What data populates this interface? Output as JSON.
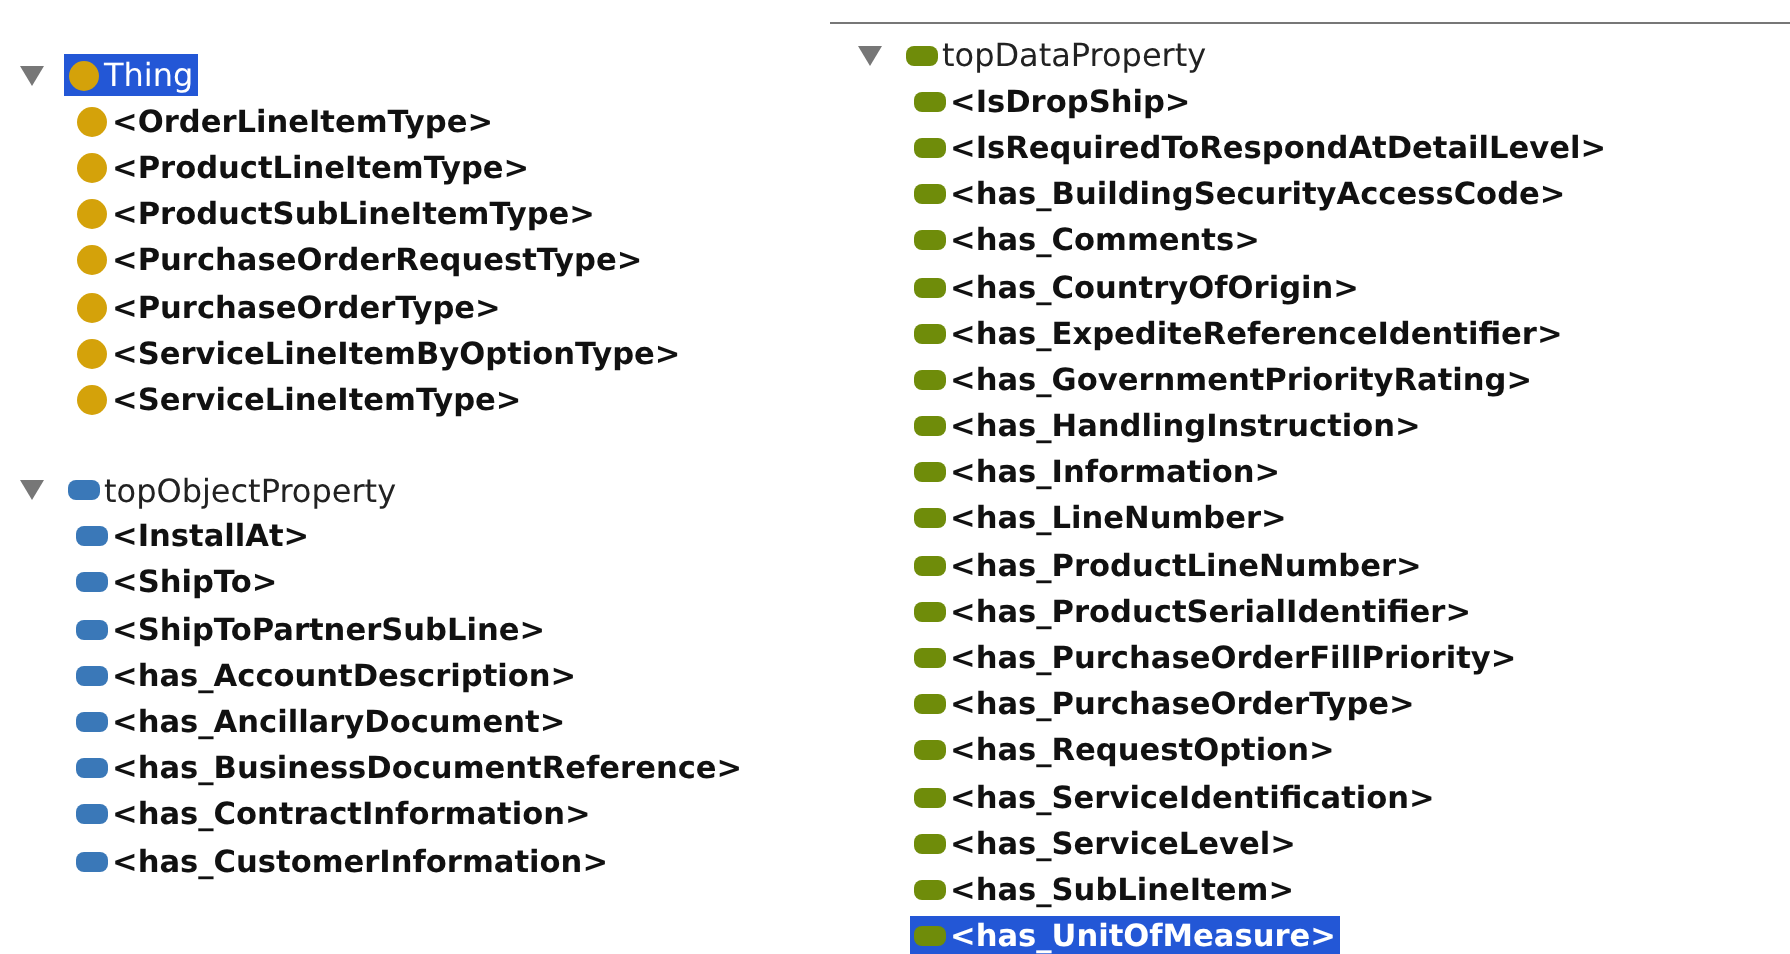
{
  "class_tree": {
    "label": "Thing",
    "kind": "class",
    "expanded": true,
    "selected": true,
    "children": [
      {
        "label": "<OrderLineItemType>",
        "selected": false
      },
      {
        "label": "<ProductLineItemType>",
        "selected": false
      },
      {
        "label": "<ProductSubLineItemType>",
        "selected": false
      },
      {
        "label": "<PurchaseOrderRequestType>",
        "selected": false
      },
      {
        "label": "<PurchaseOrderType>",
        "selected": false
      },
      {
        "label": "<ServiceLineItemByOptionType>",
        "selected": false
      },
      {
        "label": "<ServiceLineItemType>",
        "selected": false
      }
    ]
  },
  "object_property_tree": {
    "label": "topObjectProperty",
    "kind": "object",
    "expanded": true,
    "selected": false,
    "children": [
      {
        "label": "<InstallAt>",
        "selected": false
      },
      {
        "label": "<ShipTo>",
        "selected": false
      },
      {
        "label": "<ShipToPartnerSubLine>",
        "selected": false
      },
      {
        "label": "<has_AccountDescription>",
        "selected": false
      },
      {
        "label": "<has_AncillaryDocument>",
        "selected": false
      },
      {
        "label": "<has_BusinessDocumentReference>",
        "selected": false
      },
      {
        "label": "<has_ContractInformation>",
        "selected": false
      },
      {
        "label": "<has_CustomerInformation>",
        "selected": false
      }
    ]
  },
  "data_property_tree": {
    "label": "topDataProperty",
    "kind": "data",
    "expanded": true,
    "selected": false,
    "children": [
      {
        "label": "<IsDropShip>",
        "selected": false
      },
      {
        "label": "<IsRequiredToRespondAtDetailLevel>",
        "selected": false
      },
      {
        "label": "<has_BuildingSecurityAccessCode>",
        "selected": false
      },
      {
        "label": "<has_Comments>",
        "selected": false
      },
      {
        "label": "<has_CountryOfOrigin>",
        "selected": false
      },
      {
        "label": "<has_ExpediteReferenceIdentifier>",
        "selected": false
      },
      {
        "label": "<has_GovernmentPriorityRating>",
        "selected": false
      },
      {
        "label": "<has_HandlingInstruction>",
        "selected": false
      },
      {
        "label": "<has_Information>",
        "selected": false
      },
      {
        "label": "<has_LineNumber>",
        "selected": false
      },
      {
        "label": "<has_ProductLineNumber>",
        "selected": false
      },
      {
        "label": "<has_ProductSerialIdentifier>",
        "selected": false
      },
      {
        "label": "<has_PurchaseOrderFillPriority>",
        "selected": false
      },
      {
        "label": "<has_PurchaseOrderType>",
        "selected": false
      },
      {
        "label": "<has_RequestOption>",
        "selected": false
      },
      {
        "label": "<has_ServiceIdentification>",
        "selected": false
      },
      {
        "label": "<has_ServiceLevel>",
        "selected": false
      },
      {
        "label": "<has_SubLineItem>",
        "selected": false
      },
      {
        "label": "<has_UnitOfMeasure>",
        "selected": true
      }
    ]
  }
}
